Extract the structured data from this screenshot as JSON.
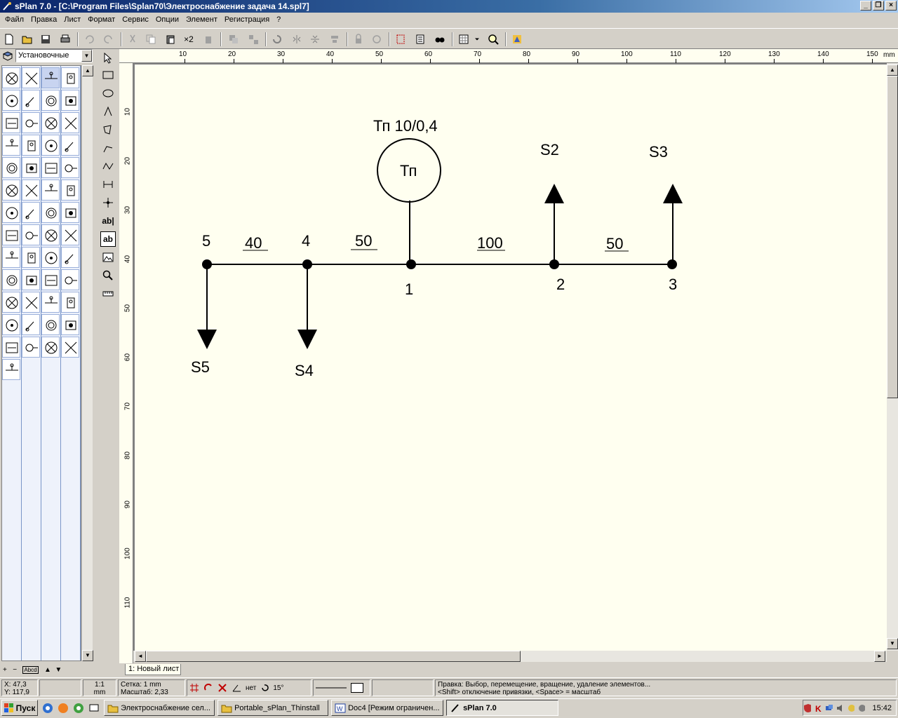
{
  "window": {
    "title": "sPlan 7.0 - [C:\\Program Files\\Splan70\\Электроснабжение задача 14.spl7]",
    "controls": [
      "_",
      "❐",
      "×"
    ]
  },
  "menu": [
    "Файл",
    "Правка",
    "Лист",
    "Формат",
    "Сервис",
    "Опции",
    "Элемент",
    "Регистрация",
    "?"
  ],
  "toolbar": {
    "multiplier_label": "×2"
  },
  "library": {
    "selected": "Установочные"
  },
  "rulers": {
    "unit": "mm",
    "h_ticks": [
      "10",
      "20",
      "30",
      "40",
      "50",
      "60",
      "70",
      "80",
      "90",
      "100",
      "110",
      "120",
      "130",
      "140",
      "150"
    ],
    "v_ticks": [
      "10",
      "20",
      "30",
      "40",
      "50",
      "60",
      "70",
      "80",
      "90",
      "100",
      "110"
    ]
  },
  "drawing_tools": {
    "text_label": "ab|",
    "text2_label": "ab"
  },
  "schematic": {
    "transformer_title": "Тп 10/0,4",
    "transformer_label": "Тп",
    "nodes": {
      "n1": "1",
      "n2": "2",
      "n3": "3",
      "n4": "4",
      "n5": "5"
    },
    "segments": {
      "s54": "40",
      "s41": "50",
      "s12": "100",
      "s23": "50"
    },
    "loads": {
      "S2": "S2",
      "S3": "S3",
      "S4": "S4",
      "S5": "S5"
    }
  },
  "sheet_tab": "1: Новый лист",
  "status": {
    "x": "X: 47,3",
    "y": "Y: 117,9",
    "scale1": "1:1",
    "scale2": "mm",
    "grid": "Сетка: 1 mm",
    "zoom": "Масштаб:  2,33",
    "snap": "нет",
    "angle": "15°",
    "hint1": "Правка: Выбор, перемещение, вращение, удаление элементов...",
    "hint2": "<Shift> отключение привязки, <Space> = масштаб"
  },
  "taskbar": {
    "start": "Пуск",
    "tasks": [
      "Электроснабжение сел...",
      "Portable_sPlan_Thinstall",
      "Doc4 [Режим ограничен...",
      "sPlan 7.0"
    ],
    "clock": "15:42"
  }
}
